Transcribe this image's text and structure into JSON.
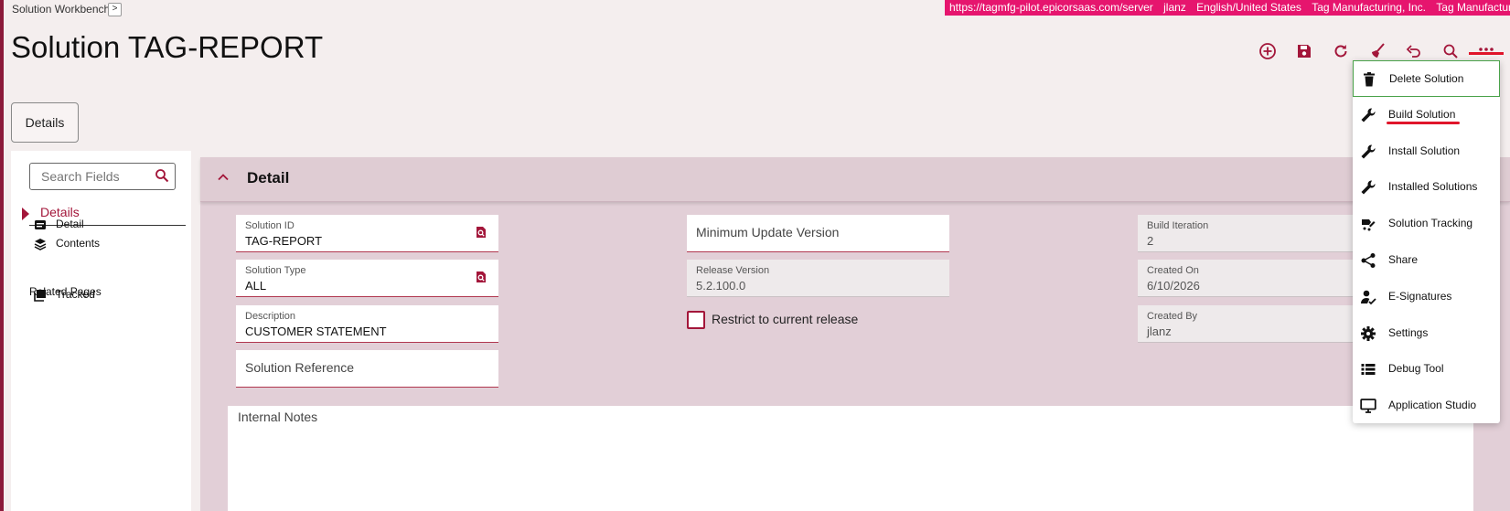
{
  "app": {
    "name": "Solution Workbench",
    "chevron": ">"
  },
  "env": {
    "url": "https://tagmfg-pilot.epicorsaas.com/server",
    "user": "jlanz",
    "language": "English/United States",
    "company": "Tag Manufacturing, Inc.",
    "site": "Tag Manufacturing Inc",
    "bar_color": "#e6156e"
  },
  "page": {
    "title": "Solution TAG-REPORT"
  },
  "toolbar": {
    "icons": [
      "add-new-icon",
      "save-icon",
      "refresh-icon",
      "clear-icon",
      "undo-icon",
      "search-icon",
      "more-icon"
    ]
  },
  "tabs": {
    "details": "Details"
  },
  "sidebar": {
    "search_placeholder": "Search Fields",
    "group": "Details",
    "items": [
      {
        "label": "Detail",
        "icon": "form-icon"
      },
      {
        "label": "Contents",
        "icon": "layers-icon"
      }
    ],
    "related_title": "Related Pages",
    "related": [
      {
        "label": "Tracked",
        "icon": "stack-icon"
      }
    ]
  },
  "detail": {
    "title": "Detail",
    "solution_id": {
      "label": "Solution ID",
      "value": "TAG-REPORT"
    },
    "solution_type": {
      "label": "Solution Type",
      "value": "ALL"
    },
    "description": {
      "label": "Description",
      "value": "CUSTOMER STATEMENT"
    },
    "solution_reference": {
      "label": "Solution Reference"
    },
    "min_update_version": {
      "label": "Minimum Update Version"
    },
    "release_version": {
      "label": "Release Version",
      "value": "5.2.100.0"
    },
    "restrict_label": "Restrict to current release",
    "restrict_checked": false,
    "build_iteration": {
      "label": "Build Iteration",
      "value": "2"
    },
    "created_on": {
      "label": "Created On",
      "value": "6/10/2026"
    },
    "created_by": {
      "label": "Created By",
      "value": "jlanz"
    },
    "internal_notes": {
      "label": "Internal Notes",
      "value": ""
    }
  },
  "menu": {
    "items": [
      {
        "label": "Delete Solution",
        "icon": "trash-icon",
        "selected": true
      },
      {
        "label": "Build Solution",
        "icon": "wrench-icon"
      },
      {
        "label": "Install Solution",
        "icon": "wrench-icon"
      },
      {
        "label": "Installed Solutions",
        "icon": "wrench-icon"
      },
      {
        "label": "Solution Tracking",
        "icon": "tracking-icon"
      },
      {
        "label": "Share",
        "icon": "share-icon"
      },
      {
        "label": "E-Signatures",
        "icon": "signature-icon"
      },
      {
        "label": "Settings",
        "icon": "gear-icon"
      },
      {
        "label": "Debug Tool",
        "icon": "list-icon"
      },
      {
        "label": "Application Studio",
        "icon": "monitor-icon"
      }
    ]
  },
  "colors": {
    "accent": "#a3163a",
    "annotation": "#e0152a",
    "panel": "#e2cfd7"
  }
}
